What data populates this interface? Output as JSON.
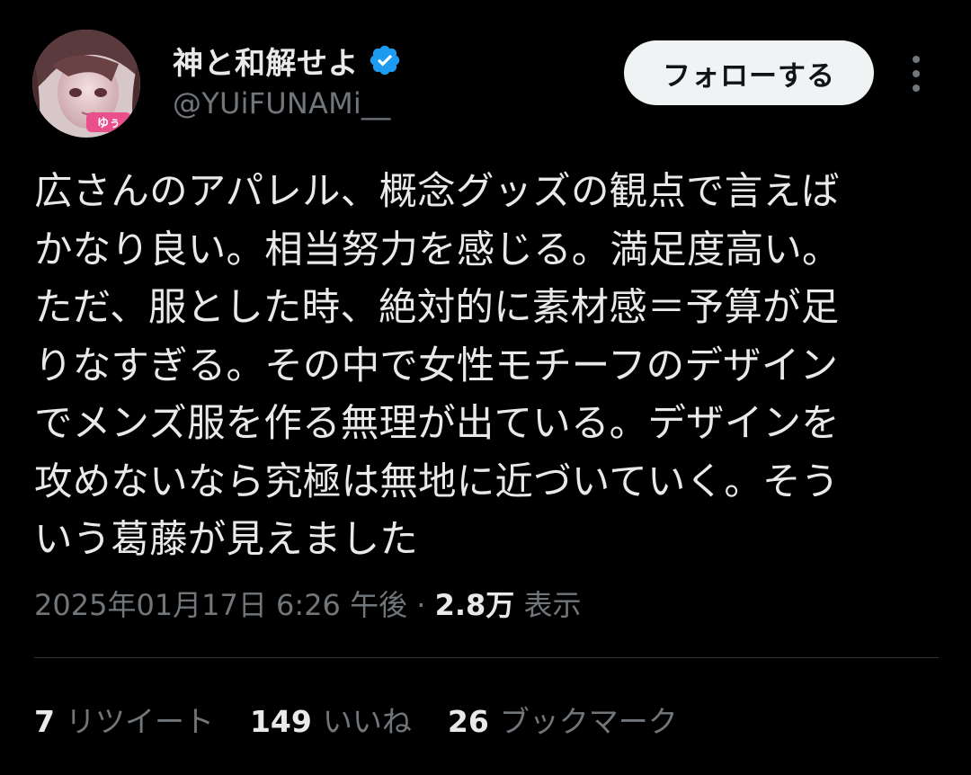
{
  "user": {
    "display_name": "神と和解せよ",
    "handle": "@YUiFUNAMi__",
    "verified_icon": "verified-badge-icon",
    "avatar_badge_text": "ゆぅ"
  },
  "actions": {
    "follow_label": "フォローする",
    "more_icon": "more-vertical-icon"
  },
  "tweet": {
    "text": "広さんのアパレル、概念グッズの観点で言えば\nかなり良い。相当努力を感じる。満足度高い。\nただ、服とした時、絶対的に素材感＝予算が足\nりなすぎる。その中で女性モチーフのデザイン\nでメンズ服を作る無理が出ている。デザインを\n攻めないなら究極は無地に近づいていく。そう\nいう葛藤が見えました",
    "timestamp": "2025年01月17日 6:26 午後",
    "separator": "·",
    "views_count": "2.8万",
    "views_label": "表示"
  },
  "stats": {
    "retweets_count": "7",
    "retweets_label": "リツイート",
    "likes_count": "149",
    "likes_label": "いいね",
    "bookmarks_count": "26",
    "bookmarks_label": "ブックマーク"
  },
  "colors": {
    "background": "#000000",
    "primary_text": "#e7e9ea",
    "secondary_text": "#71767b",
    "verified_blue": "#1d9bf0",
    "follow_button_bg": "#eff3f4",
    "divider": "#2f3336"
  }
}
